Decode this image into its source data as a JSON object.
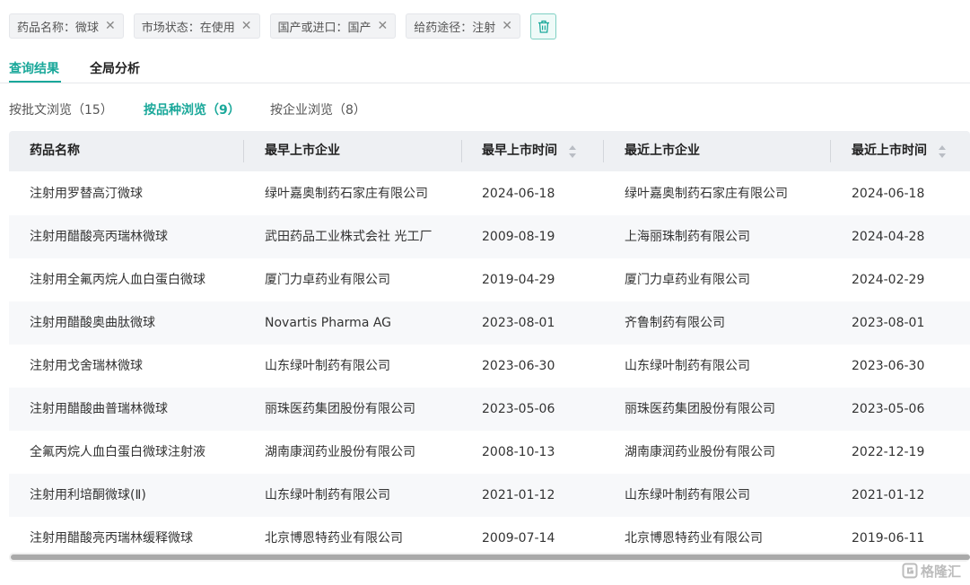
{
  "filters": [
    {
      "label": "药品名称：微球"
    },
    {
      "label": "市场状态：在使用"
    },
    {
      "label": "国产或进口：国产"
    },
    {
      "label": "给药途径：注射"
    }
  ],
  "icons": {
    "close": "close-icon",
    "clear": "trash-icon",
    "sort": "sort-icon",
    "watermark": "gelonghui-logo"
  },
  "colors": {
    "accent": "#1aa89a",
    "header_bg": "#eef0f3",
    "row_alt": "#f7f8fa"
  },
  "tabs": [
    {
      "label": "查询结果",
      "active": true
    },
    {
      "label": "全局分析",
      "active": false
    }
  ],
  "subtabs": [
    {
      "label": "按批文浏览（15）",
      "active": false
    },
    {
      "label": "按品种浏览（9）",
      "active": true
    },
    {
      "label": "按企业浏览（8）",
      "active": false
    }
  ],
  "table": {
    "columns": [
      "药品名称",
      "最早上市企业",
      "最早上市时间",
      "最近上市企业",
      "最近上市时间"
    ],
    "rows": [
      [
        "注射用罗替高汀微球",
        "绿叶嘉奥制药石家庄有限公司",
        "2024-06-18",
        "绿叶嘉奥制药石家庄有限公司",
        "2024-06-18"
      ],
      [
        "注射用醋酸亮丙瑞林微球",
        "武田药品工业株式会社 光工厂",
        "2009-08-19",
        "上海丽珠制药有限公司",
        "2024-04-28"
      ],
      [
        "注射用全氟丙烷人血白蛋白微球",
        "厦门力卓药业有限公司",
        "2019-04-29",
        "厦门力卓药业有限公司",
        "2024-02-29"
      ],
      [
        "注射用醋酸奥曲肽微球",
        "Novartis Pharma AG",
        "2023-08-01",
        "齐鲁制药有限公司",
        "2023-08-01"
      ],
      [
        "注射用戈舍瑞林微球",
        "山东绿叶制药有限公司",
        "2023-06-30",
        "山东绿叶制药有限公司",
        "2023-06-30"
      ],
      [
        "注射用醋酸曲普瑞林微球",
        "丽珠医药集团股份有限公司",
        "2023-05-06",
        "丽珠医药集团股份有限公司",
        "2023-05-06"
      ],
      [
        "全氟丙烷人血白蛋白微球注射液",
        "湖南康润药业股份有限公司",
        "2008-10-13",
        "湖南康润药业股份有限公司",
        "2022-12-19"
      ],
      [
        "注射用利培酮微球(Ⅱ)",
        "山东绿叶制药有限公司",
        "2021-01-12",
        "山东绿叶制药有限公司",
        "2021-01-12"
      ],
      [
        "注射用醋酸亮丙瑞林缓释微球",
        "北京博恩特药业有限公司",
        "2009-07-14",
        "北京博恩特药业有限公司",
        "2019-06-11"
      ]
    ]
  },
  "watermark": {
    "text": "格隆汇"
  }
}
